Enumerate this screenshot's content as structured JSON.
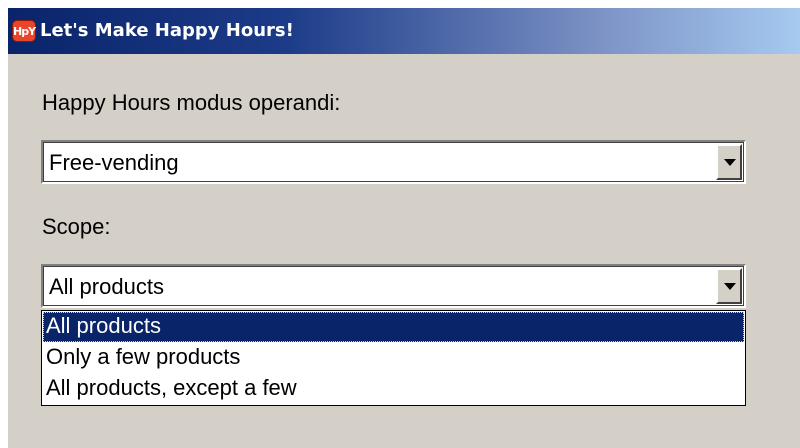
{
  "window": {
    "title": "Let's Make Happy Hours!",
    "icon_text": "HpY"
  },
  "form": {
    "mode_label": "Happy Hours modus operandi:",
    "mode_value": "Free-vending",
    "scope_label": "Scope:",
    "scope_value": "All products",
    "scope_options": [
      {
        "label": "All products",
        "selected": true
      },
      {
        "label": "Only a few products",
        "selected": false
      },
      {
        "label": "All products, except a few",
        "selected": false
      }
    ]
  },
  "colors": {
    "title_bar": "#0a246a",
    "face": "#d4d0c8",
    "highlight": "#0a246a"
  }
}
